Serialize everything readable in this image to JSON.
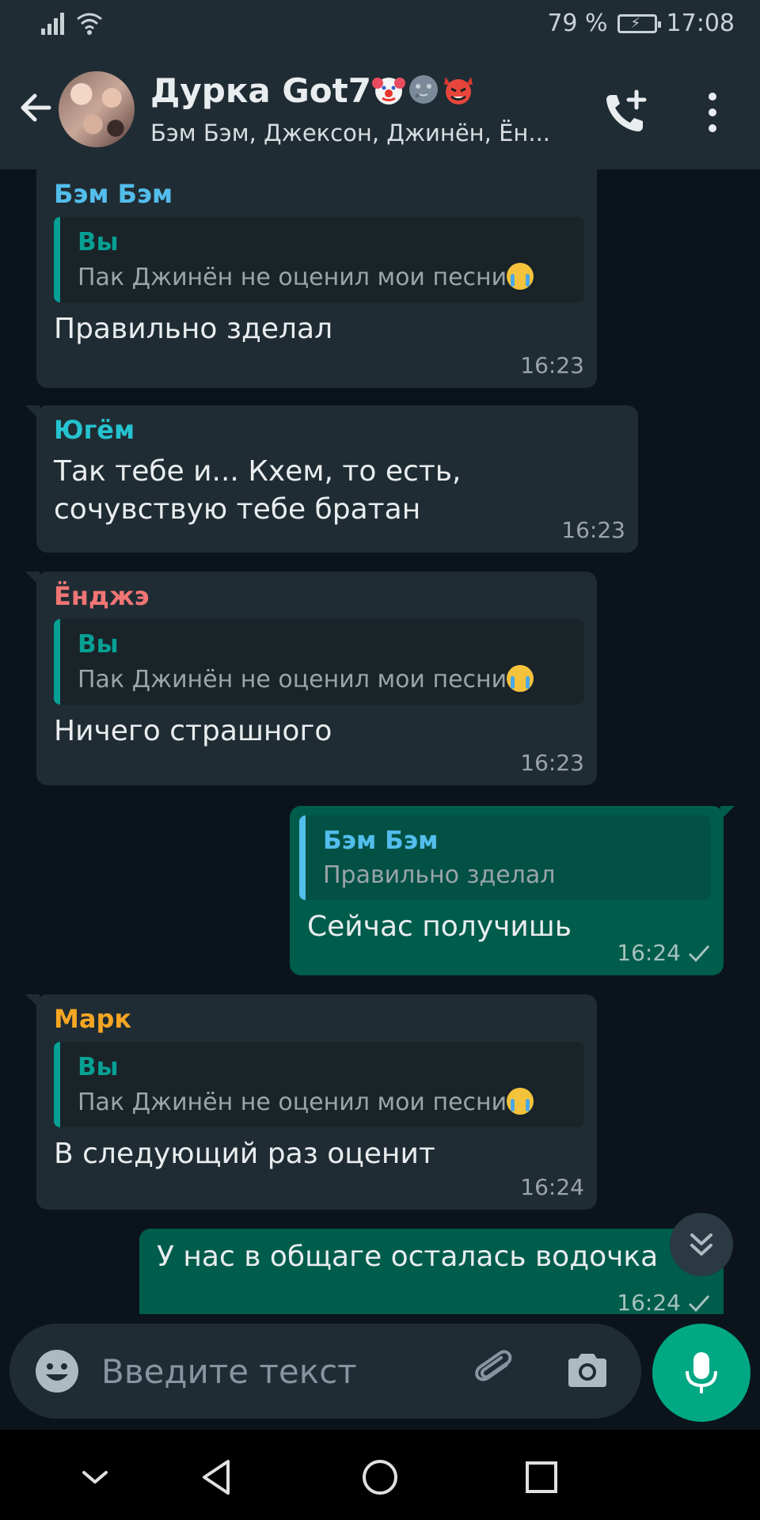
{
  "status_bar": {
    "battery": "79 %",
    "time": "17:08"
  },
  "header": {
    "title": "Дурка Got7",
    "title_emojis": [
      "clown-face",
      "new-moon-face",
      "smiling-devil"
    ],
    "subtitle": "Бэм Бэм, Джексон, Джинён, Ён..."
  },
  "messages": [
    {
      "sender": "Бэм Бэм",
      "sender_color": "#53bdeb",
      "quote_name": "Вы",
      "quote_text": "Пак Джинён не оценил мои песни",
      "quote_emoji": "crying-face",
      "text": "Правильно зделал",
      "time": "16:23"
    },
    {
      "sender": "Югём",
      "sender_color": "#25c2cf",
      "text_line1": "Так тебе и...  Кхем,  то есть,",
      "text_line2": "сочувствую тебе братан",
      "time": "16:23"
    },
    {
      "sender": "Ёнджэ",
      "sender_color": "#f07575",
      "quote_name": "Вы",
      "quote_text": "Пак Джинён не оценил мои песни",
      "quote_emoji": "crying-face",
      "text": "Ничего страшного",
      "time": "16:23"
    },
    {
      "direction": "out",
      "quote_name": "Бэм Бэм",
      "quote_text": "Правильно зделал",
      "text": "Сейчас получишь",
      "time": "16:24",
      "status": "sent"
    },
    {
      "sender": "Марк",
      "sender_color": "#f5a623",
      "quote_name": "Вы",
      "quote_text": "Пак Джинён не оценил мои песни",
      "quote_emoji": "crying-face",
      "text": "В следующий раз оценит",
      "time": "16:24"
    },
    {
      "direction": "out",
      "text": "У нас в общаге осталась водочка",
      "time": "16:24",
      "status": "sent"
    }
  ],
  "input": {
    "placeholder": "Введите текст"
  },
  "colors": {
    "accent": "#00a884",
    "header_bg": "#1f2c34",
    "chat_bg": "#0b141a",
    "bubble_in": "#202c33",
    "bubble_out": "#005c4b"
  }
}
